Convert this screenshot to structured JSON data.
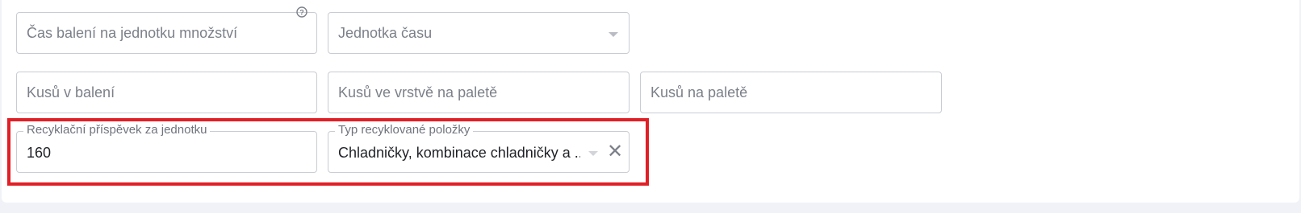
{
  "row1": {
    "packing_time": {
      "placeholder": "Čas balení na jednotku množství"
    },
    "time_unit": {
      "placeholder": "Jednotka času"
    }
  },
  "row2": {
    "pieces_in_package": {
      "placeholder": "Kusů v balení"
    },
    "pieces_per_layer": {
      "placeholder": "Kusů ve vrstvě na paletě"
    },
    "pieces_per_pallet": {
      "placeholder": "Kusů na paletě"
    }
  },
  "row3": {
    "recycling_fee": {
      "label": "Recyklační příspěvek za jednotku",
      "value": "160"
    },
    "recycled_item_type": {
      "label": "Typ recyklované položky",
      "value": "Chladničky, kombinace chladničky a ..."
    }
  },
  "icons": {
    "help": "question-circle-icon",
    "dropdown": "chevron-down-icon",
    "clear": "close-icon"
  },
  "colors": {
    "highlight": "#e11f26",
    "border": "#c9ccd3",
    "placeholder": "#7c8089"
  }
}
